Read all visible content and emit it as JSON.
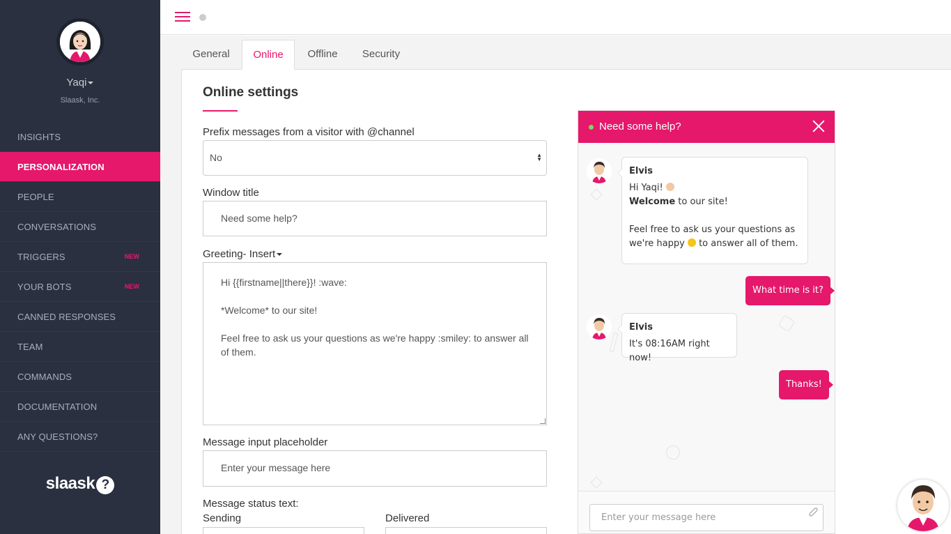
{
  "user": {
    "name": "Yaqi",
    "company": "Slaask, Inc."
  },
  "sidebar": {
    "items": [
      {
        "label": "INSIGHTS"
      },
      {
        "label": "PERSONALIZATION"
      },
      {
        "label": "PEOPLE"
      },
      {
        "label": "CONVERSATIONS"
      },
      {
        "label": "TRIGGERS",
        "badge": "NEW"
      },
      {
        "label": "YOUR BOTS",
        "badge": "NEW"
      },
      {
        "label": "CANNED RESPONSES"
      },
      {
        "label": "TEAM"
      },
      {
        "label": "COMMANDS"
      },
      {
        "label": "DOCUMENTATION"
      },
      {
        "label": "ANY QUESTIONS?"
      }
    ],
    "brand": "slaask",
    "brand_mark": "?"
  },
  "tabs": [
    {
      "label": "General"
    },
    {
      "label": "Online"
    },
    {
      "label": "Offline"
    },
    {
      "label": "Security"
    }
  ],
  "form": {
    "title": "Online settings",
    "prefix_label": "Prefix messages from a visitor with @channel",
    "prefix_value": "No",
    "window_title_label": "Window title",
    "window_title_value": "Need some help?",
    "greeting_label": "Greeting- Insert",
    "greeting_lines": [
      "Hi {{firstname||there}}! :wave:",
      "*Welcome* to our site!",
      "",
      "Feel free to ask us your questions as we're happy :smiley: to answer all of them."
    ],
    "placeholder_label": "Message input placeholder",
    "placeholder_value": "Enter your message here",
    "status_label": "Message status text:",
    "sending_label": "Sending",
    "delivered_label": "Delivered"
  },
  "chat": {
    "header": "Need some help?",
    "messages": [
      {
        "sender": "Elvis",
        "line1": "Hi Yaqi!",
        "bold": "Welcome",
        "line2_rest": " to our site!",
        "line3a": "Feel free to ask us your questions as",
        "line3b_pre": "we're happy ",
        "line3b_post": " to answer all of them."
      },
      {
        "text": "What time is it?"
      },
      {
        "sender": "Elvis",
        "text": "It's 08:16AM right now!"
      },
      {
        "text": "Thanks!"
      }
    ],
    "input_placeholder": "Enter your message here"
  },
  "colors": {
    "accent": "#e5186b",
    "sidebar_bg": "#2b3040",
    "online": "#7ed957"
  },
  "icons": [
    "hamburger-menu-icon",
    "close-icon",
    "paperclip-icon",
    "help-circle-icon"
  ]
}
